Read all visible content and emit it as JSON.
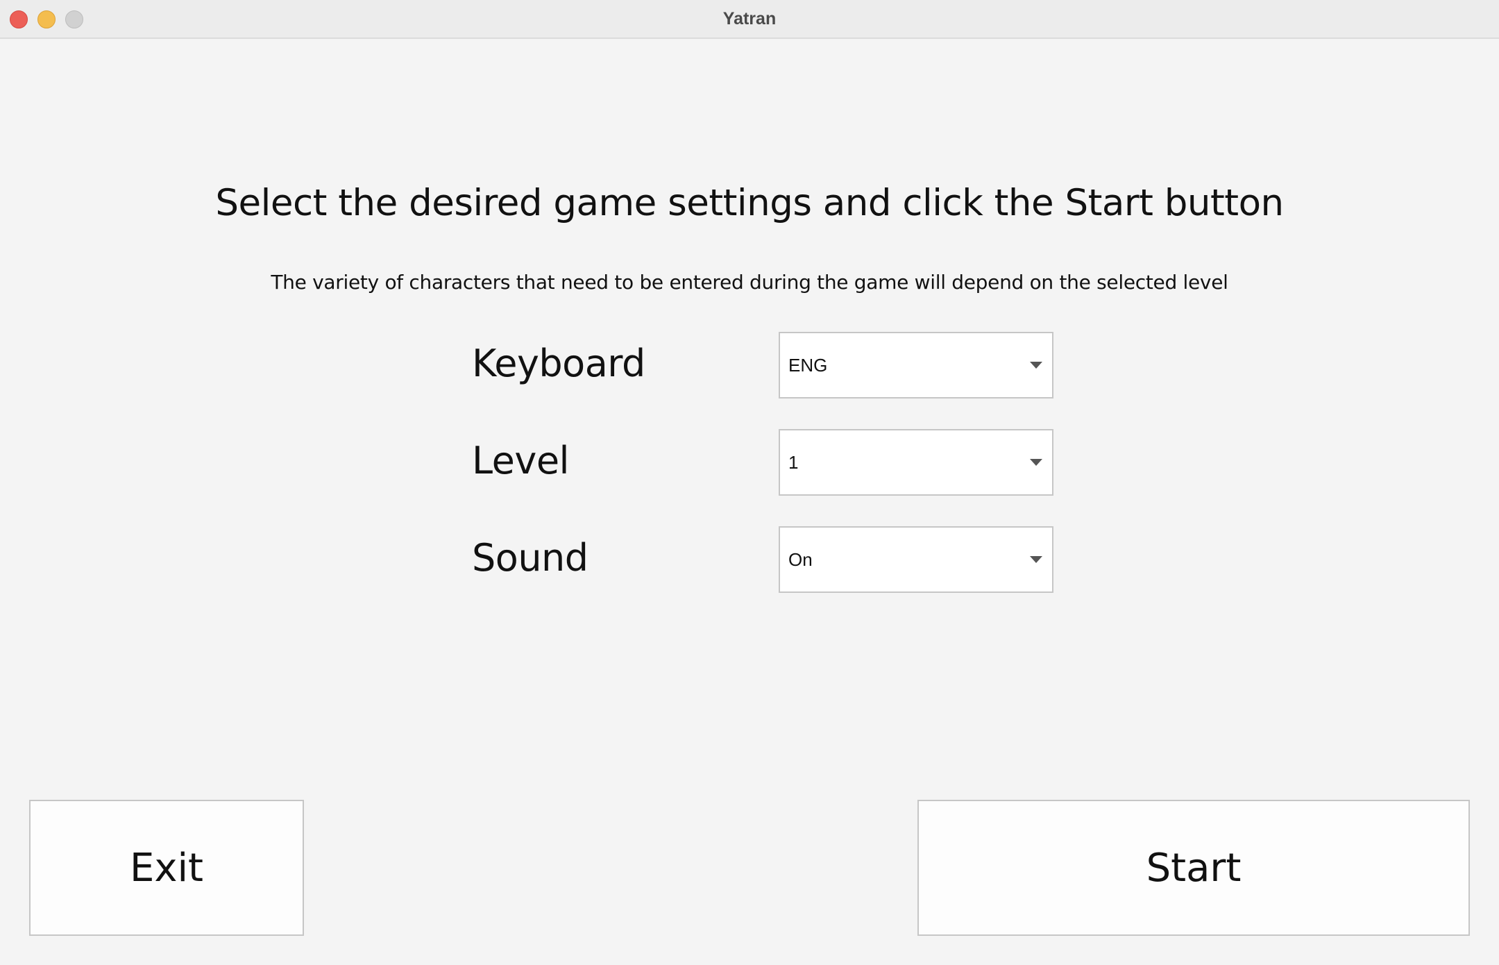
{
  "window": {
    "title": "Yatran"
  },
  "main": {
    "heading": "Select the desired game settings and click the Start button",
    "subheading": "The variety of characters that need to be entered during the game will depend on the selected level"
  },
  "settings": {
    "keyboard": {
      "label": "Keyboard",
      "value": "ENG"
    },
    "level": {
      "label": "Level",
      "value": "1"
    },
    "sound": {
      "label": "Sound",
      "value": "On"
    }
  },
  "buttons": {
    "exit_label": "Exit",
    "start_label": "Start"
  },
  "colors": {
    "background": "#f4f4f4",
    "close": "#ec5f57",
    "minimize": "#f4bd4f",
    "zoom_disabled": "#d1d1d1"
  }
}
